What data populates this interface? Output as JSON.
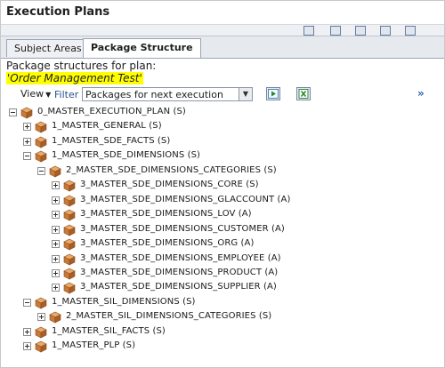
{
  "window": {
    "title": "Execution Plans"
  },
  "tabs": [
    {
      "label": "Subject Areas",
      "active": false
    },
    {
      "label": "Package Structure",
      "active": true
    }
  ],
  "plan": {
    "label": "Package structures for plan:",
    "name": "'Order Management Test'"
  },
  "viewbar": {
    "view_label": "View",
    "filter_label": "Filter",
    "filter_value": "Packages for next execution",
    "more": "»"
  },
  "tree": [
    {
      "name": "0_MASTER_EXECUTION_PLAN (S)",
      "level": 0,
      "expanded": true
    },
    {
      "name": "1_MASTER_GENERAL (S)",
      "level": 1,
      "expanded": false
    },
    {
      "name": "1_MASTER_SDE_FACTS (S)",
      "level": 1,
      "expanded": false
    },
    {
      "name": "1_MASTER_SDE_DIMENSIONS (S)",
      "level": 1,
      "expanded": true
    },
    {
      "name": "2_MASTER_SDE_DIMENSIONS_CATEGORIES (S)",
      "level": 2,
      "expanded": true
    },
    {
      "name": "3_MASTER_SDE_DIMENSIONS_CORE (S)",
      "level": 3,
      "expanded": false
    },
    {
      "name": "3_MASTER_SDE_DIMENSIONS_GLACCOUNT (A)",
      "level": 3,
      "expanded": false
    },
    {
      "name": "3_MASTER_SDE_DIMENSIONS_LOV (A)",
      "level": 3,
      "expanded": false
    },
    {
      "name": "3_MASTER_SDE_DIMENSIONS_CUSTOMER (A)",
      "level": 3,
      "expanded": false
    },
    {
      "name": "3_MASTER_SDE_DIMENSIONS_ORG (A)",
      "level": 3,
      "expanded": false
    },
    {
      "name": "3_MASTER_SDE_DIMENSIONS_EMPLOYEE (A)",
      "level": 3,
      "expanded": false
    },
    {
      "name": "3_MASTER_SDE_DIMENSIONS_PRODUCT (A)",
      "level": 3,
      "expanded": false
    },
    {
      "name": "3_MASTER_SDE_DIMENSIONS_SUPPLIER (A)",
      "level": 3,
      "expanded": false
    },
    {
      "name": "1_MASTER_SIL_DIMENSIONS (S)",
      "level": 1,
      "expanded": true
    },
    {
      "name": "2_MASTER_SIL_DIMENSIONS_CATEGORIES (S)",
      "level": 2,
      "expanded": false
    },
    {
      "name": "1_MASTER_SIL_FACTS (S)",
      "level": 1,
      "expanded": false
    },
    {
      "name": "1_MASTER_PLP (S)",
      "level": 1,
      "expanded": false
    }
  ],
  "colors": {
    "highlight": "#ffff00",
    "package_icon": "#c87a3a",
    "tab_border": "#9aa6b6"
  },
  "icons": [
    "run-icon",
    "excel-export-icon",
    "package-icon",
    "expand-icon",
    "collapse-icon"
  ]
}
